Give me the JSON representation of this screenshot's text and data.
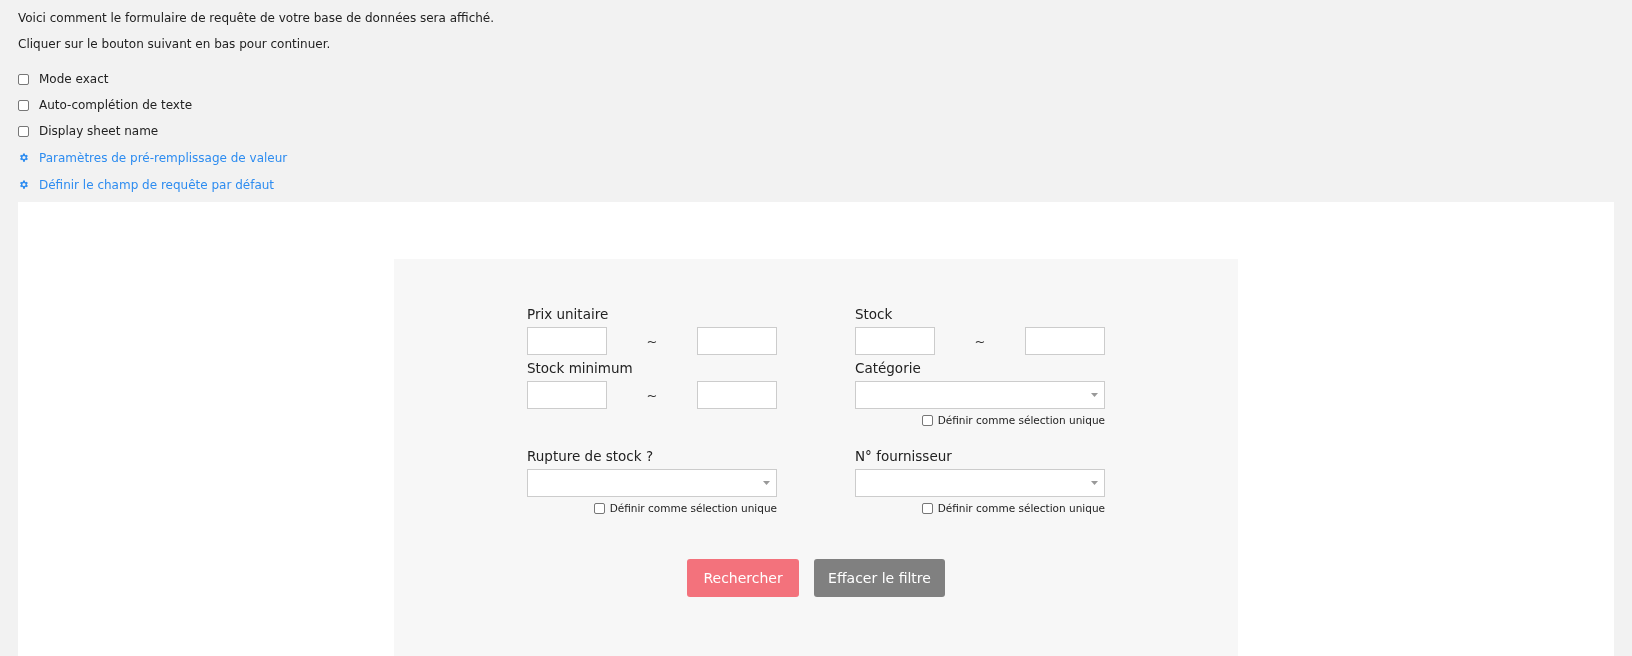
{
  "intro": [
    "Voici comment le formulaire de requête de votre base de données sera affiché.",
    "Cliquer sur le bouton suivant en bas pour continuer."
  ],
  "options": [
    {
      "label": "Mode exact",
      "checked": false
    },
    {
      "label": "Auto-complétion de texte",
      "checked": false
    },
    {
      "label": "Display sheet name",
      "checked": false
    }
  ],
  "links": [
    "Paramètres de pré-remplissage de valeur",
    "Définir le champ de requête par défaut"
  ],
  "form": {
    "fields": [
      {
        "kind": "range",
        "label": "Prix unitaire",
        "separator": "~"
      },
      {
        "kind": "range",
        "label": "Stock",
        "separator": "~"
      },
      {
        "kind": "range",
        "label": "Stock minimum",
        "separator": "~"
      },
      {
        "kind": "select",
        "label": "Catégorie",
        "option_label": "Définir comme sélection unique",
        "checked": false
      },
      {
        "kind": "select",
        "label": "Rupture de stock ?",
        "option_label": "Définir comme sélection unique",
        "checked": false
      },
      {
        "kind": "select",
        "label": "N° fournisseur",
        "option_label": "Définir comme sélection unique",
        "checked": false
      }
    ],
    "buttons": [
      {
        "kind": "primary",
        "label": "Rechercher"
      },
      {
        "kind": "secondary",
        "label": "Effacer le filtre"
      }
    ]
  }
}
